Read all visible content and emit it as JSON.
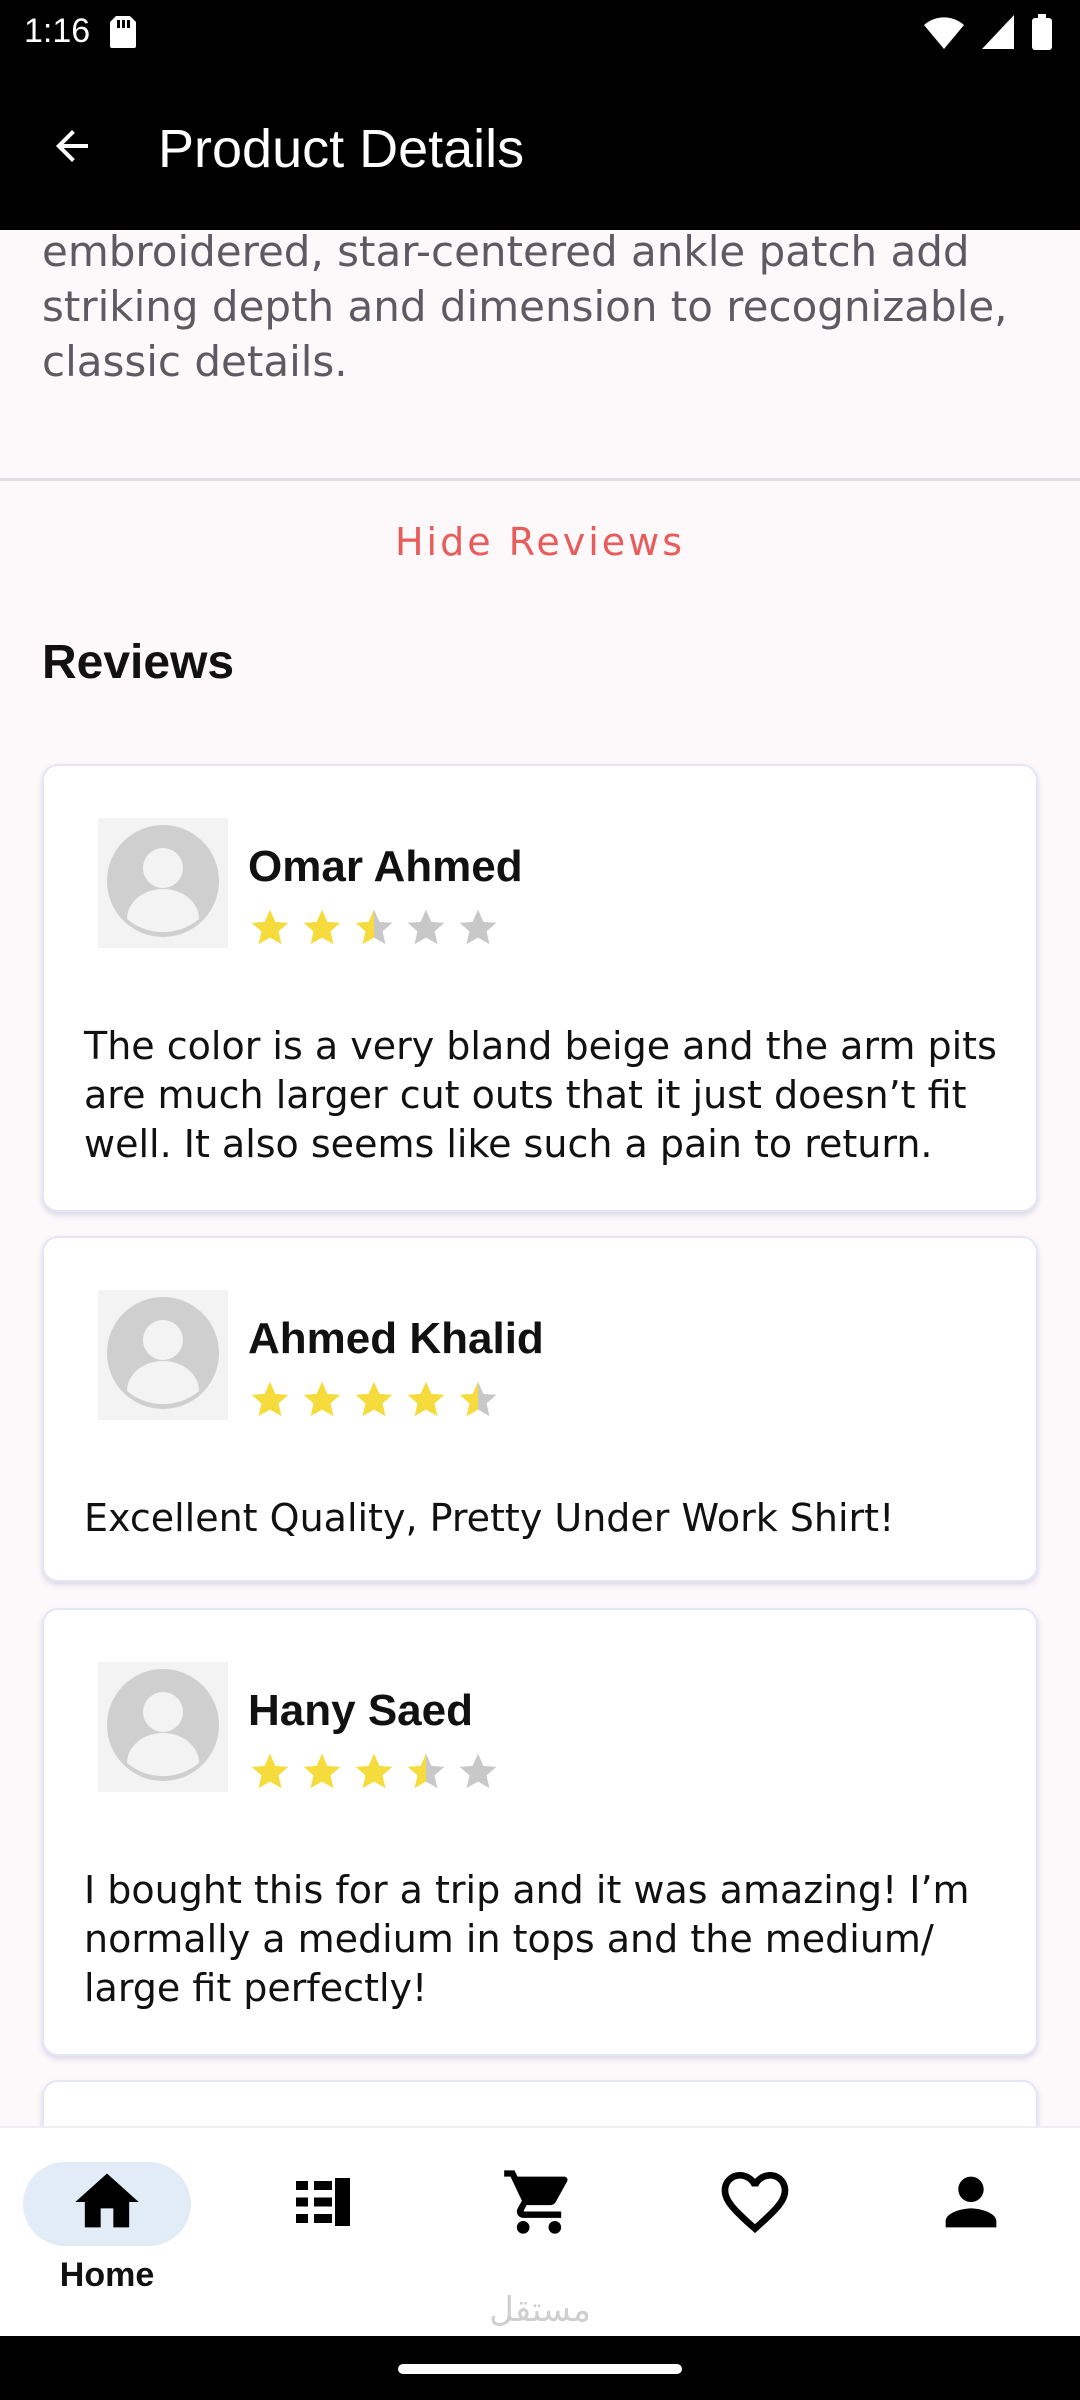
{
  "status_bar": {
    "time": "1:16",
    "icons": [
      "sim-card-icon",
      "wifi-icon",
      "signal-icon",
      "battery-icon"
    ]
  },
  "app_bar": {
    "title": "Product Details",
    "back_icon": "arrow-back-icon"
  },
  "description": {
    "text": "embroidered, star-centered ankle patch add striking depth and dimension to recognizable, classic details."
  },
  "hide_reviews_label": "Hide Reviews",
  "reviews_heading": "Reviews",
  "reviews": [
    {
      "name": "Omar Ahmed",
      "rating": 2.5,
      "text": "The color is a very bland beige and the arm pits are much larger cut outs that it just doesn’t fit well. It also seems like such a pain to return."
    },
    {
      "name": "Ahmed Khalid",
      "rating": 4.5,
      "text": "Excellent Quality, Pretty Under Work Shirt!"
    },
    {
      "name": "Hany Saed",
      "rating": 3.5,
      "text": "I bought this for a trip and it was amazing! I’m normally a medium in tops and the medium/ large fit perfectly!"
    }
  ],
  "bottom_nav": {
    "items": [
      {
        "label": "Home",
        "icon": "home-icon",
        "active": true
      },
      {
        "label": "",
        "icon": "list-icon",
        "active": false
      },
      {
        "label": "",
        "icon": "cart-icon",
        "active": false
      },
      {
        "label": "",
        "icon": "heart-icon",
        "active": false
      },
      {
        "label": "",
        "icon": "person-icon",
        "active": false
      }
    ]
  },
  "watermark": "مستقل",
  "colors": {
    "accent": "#e85c5c",
    "star_filled": "#f5dc3c",
    "star_empty": "#c8c8c8",
    "nav_active_pill": "#e1ecf7"
  }
}
